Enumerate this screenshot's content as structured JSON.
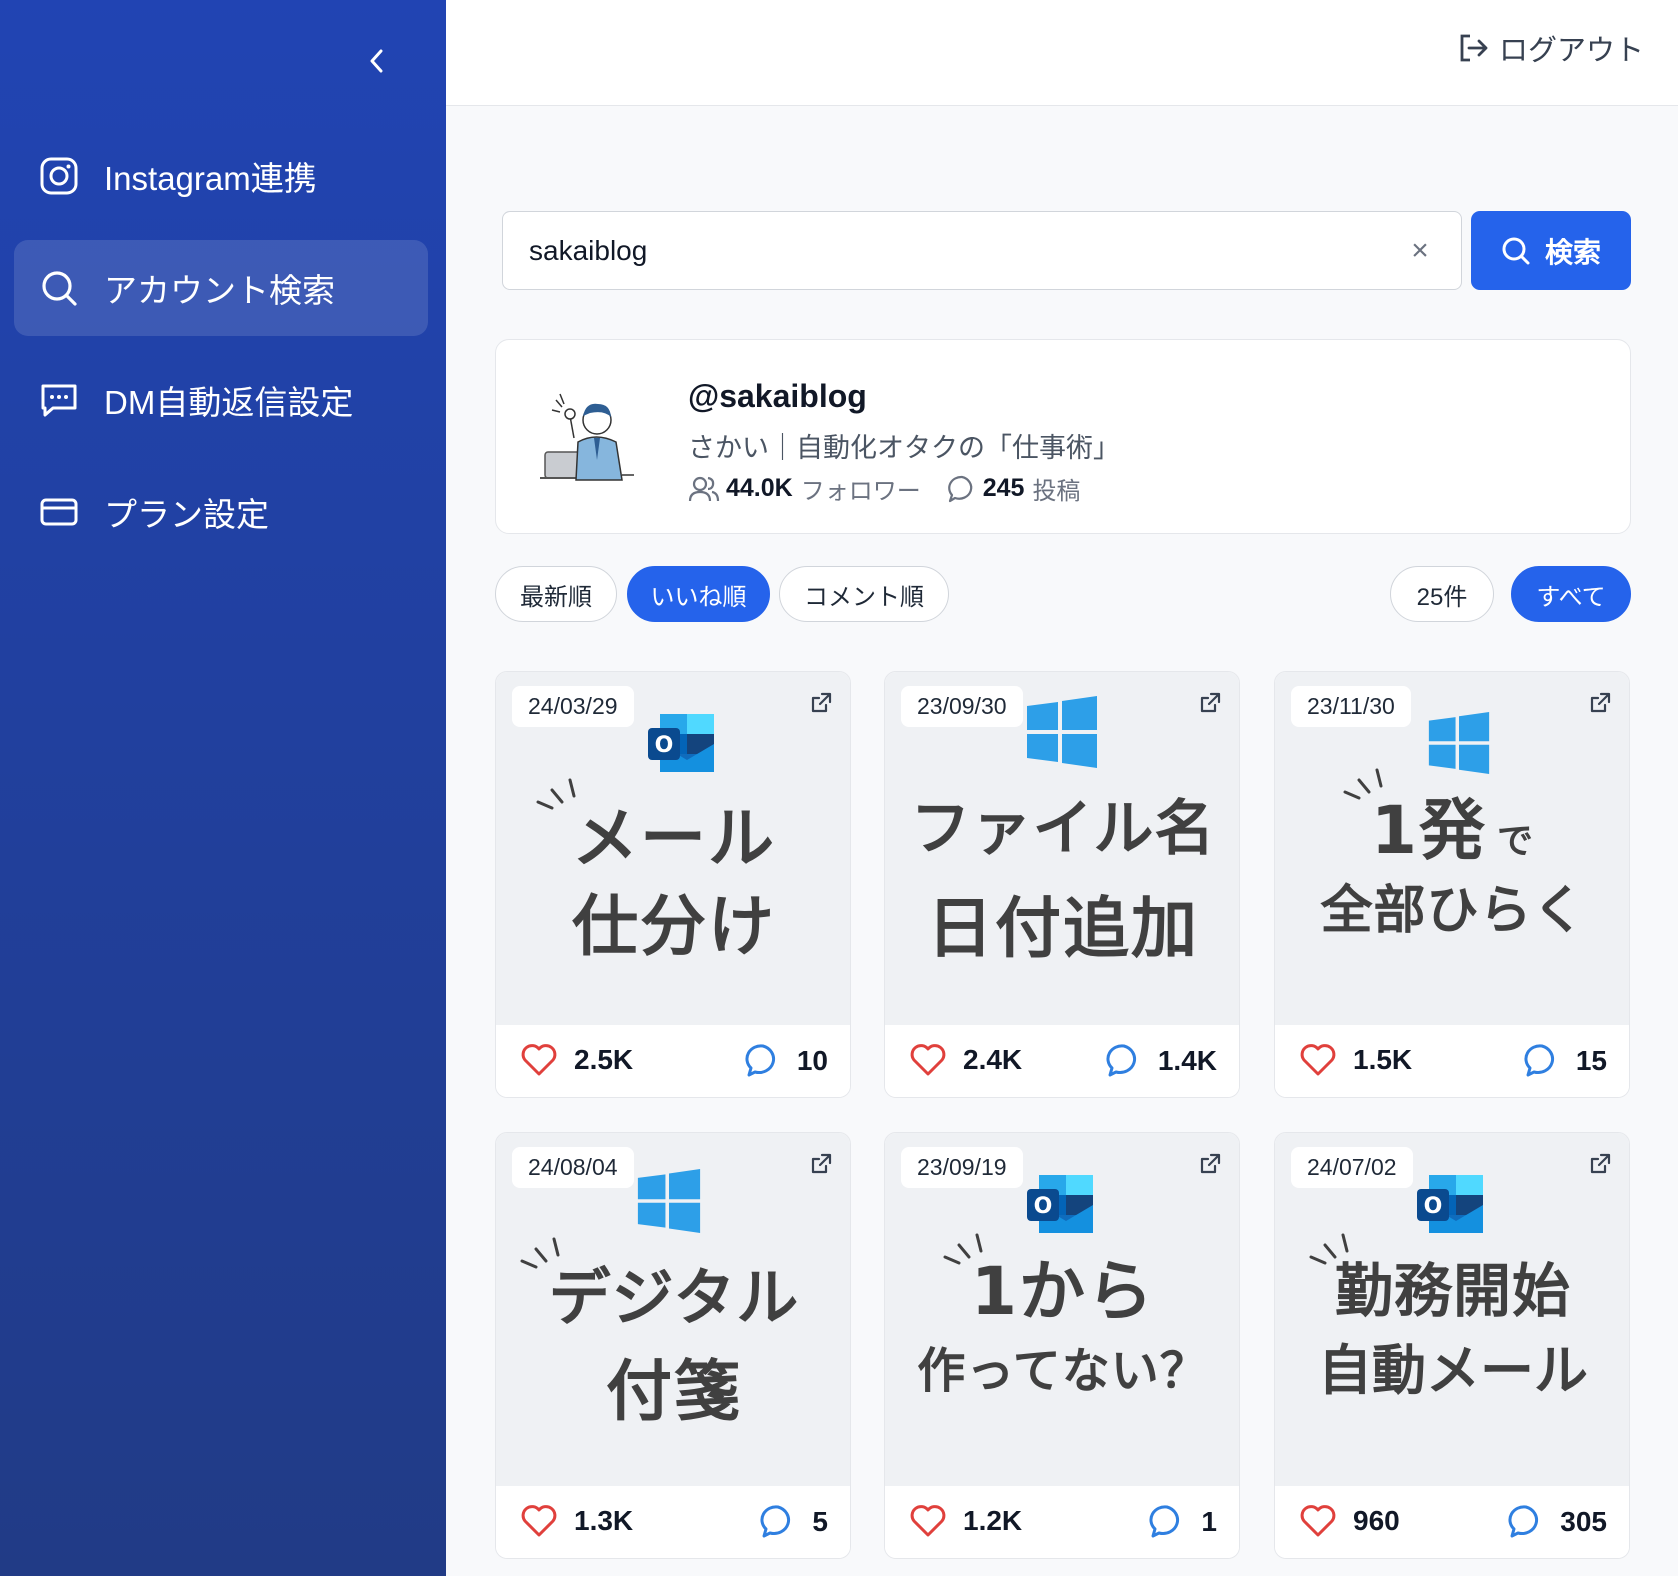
{
  "sidebar": {
    "items": [
      {
        "label": "Instagram連携",
        "icon": "instagram-icon"
      },
      {
        "label": "アカウント検索",
        "icon": "search-icon",
        "active": true
      },
      {
        "label": "DM自動返信設定",
        "icon": "message-icon"
      },
      {
        "label": "プラン設定",
        "icon": "credit-card-icon"
      }
    ]
  },
  "header": {
    "logout_label": "ログアウト"
  },
  "search": {
    "value": "sakaiblog",
    "clear_label": "×",
    "button_label": "検索"
  },
  "profile": {
    "handle": "@sakaiblog",
    "bio": "さかい｜自動化オタクの「仕事術」",
    "followers_value": "44.0K",
    "followers_label": "フォロワー",
    "posts_value": "245",
    "posts_label": "投稿"
  },
  "filters": {
    "sort": [
      "最新順",
      "いいね順",
      "コメント順"
    ],
    "active_sort": "いいね順",
    "count_label": "25件",
    "all_label": "すべて"
  },
  "colors": {
    "sidebar": "#2144b3",
    "accent": "#2563eb",
    "heart": "#e0403c",
    "comment": "#2f7fe0"
  },
  "posts": [
    {
      "date": "24/03/29",
      "logo": "outlook-icon",
      "line1": "メール",
      "line2": "仕分け",
      "likes": "2.5K",
      "comments": "10"
    },
    {
      "date": "23/09/30",
      "logo": "windows-icon",
      "line1": "ファイル名",
      "line2": "日付追加",
      "likes": "2.4K",
      "comments": "1.4K"
    },
    {
      "date": "23/11/30",
      "logo": "windows-icon",
      "line1": "1発",
      "line1_suffix": "で",
      "line2": "全部ひらく",
      "likes": "1.5K",
      "comments": "15"
    },
    {
      "date": "24/08/04",
      "logo": "windows-icon",
      "line1": "デジタル",
      "line2": "付箋",
      "likes": "1.3K",
      "comments": "5"
    },
    {
      "date": "23/09/19",
      "logo": "outlook-icon",
      "line1": "1から",
      "line2": "作ってない？",
      "likes": "1.2K",
      "comments": "1"
    },
    {
      "date": "24/07/02",
      "logo": "outlook-icon",
      "line1": "勤務開始",
      "line2": "自動メール",
      "likes": "960",
      "comments": "305"
    }
  ]
}
